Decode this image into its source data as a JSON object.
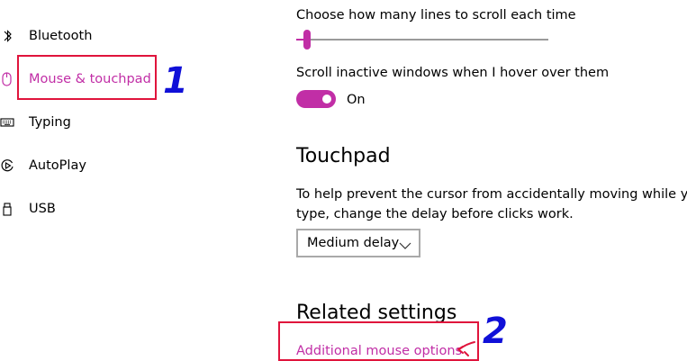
{
  "colors": {
    "accent": "#c12ea6",
    "annotation_box": "#e0143c",
    "annotation_number": "#1010d8"
  },
  "sidebar": {
    "items": [
      {
        "label": "Bluetooth",
        "icon": "bluetooth-icon"
      },
      {
        "label": "Mouse & touchpad",
        "icon": "mouse-icon",
        "selected": true
      },
      {
        "label": "Typing",
        "icon": "keyboard-icon"
      },
      {
        "label": "AutoPlay",
        "icon": "autoplay-icon"
      },
      {
        "label": "USB",
        "icon": "usb-icon"
      }
    ]
  },
  "annotations": {
    "step1": "1",
    "step2": "2"
  },
  "main": {
    "scroll_lines": {
      "label": "Choose how many lines to scroll each time",
      "slider_fraction": 0.03
    },
    "scroll_inactive": {
      "label": "Scroll inactive windows when I hover over them",
      "state": "On"
    },
    "touchpad": {
      "heading": "Touchpad",
      "description_line1": "To help prevent the cursor from accidentally moving while you",
      "description_line2": "type, change the delay before clicks work.",
      "delay_value": "Medium delay"
    },
    "related": {
      "heading": "Related settings",
      "link": "Additional mouse options"
    }
  }
}
